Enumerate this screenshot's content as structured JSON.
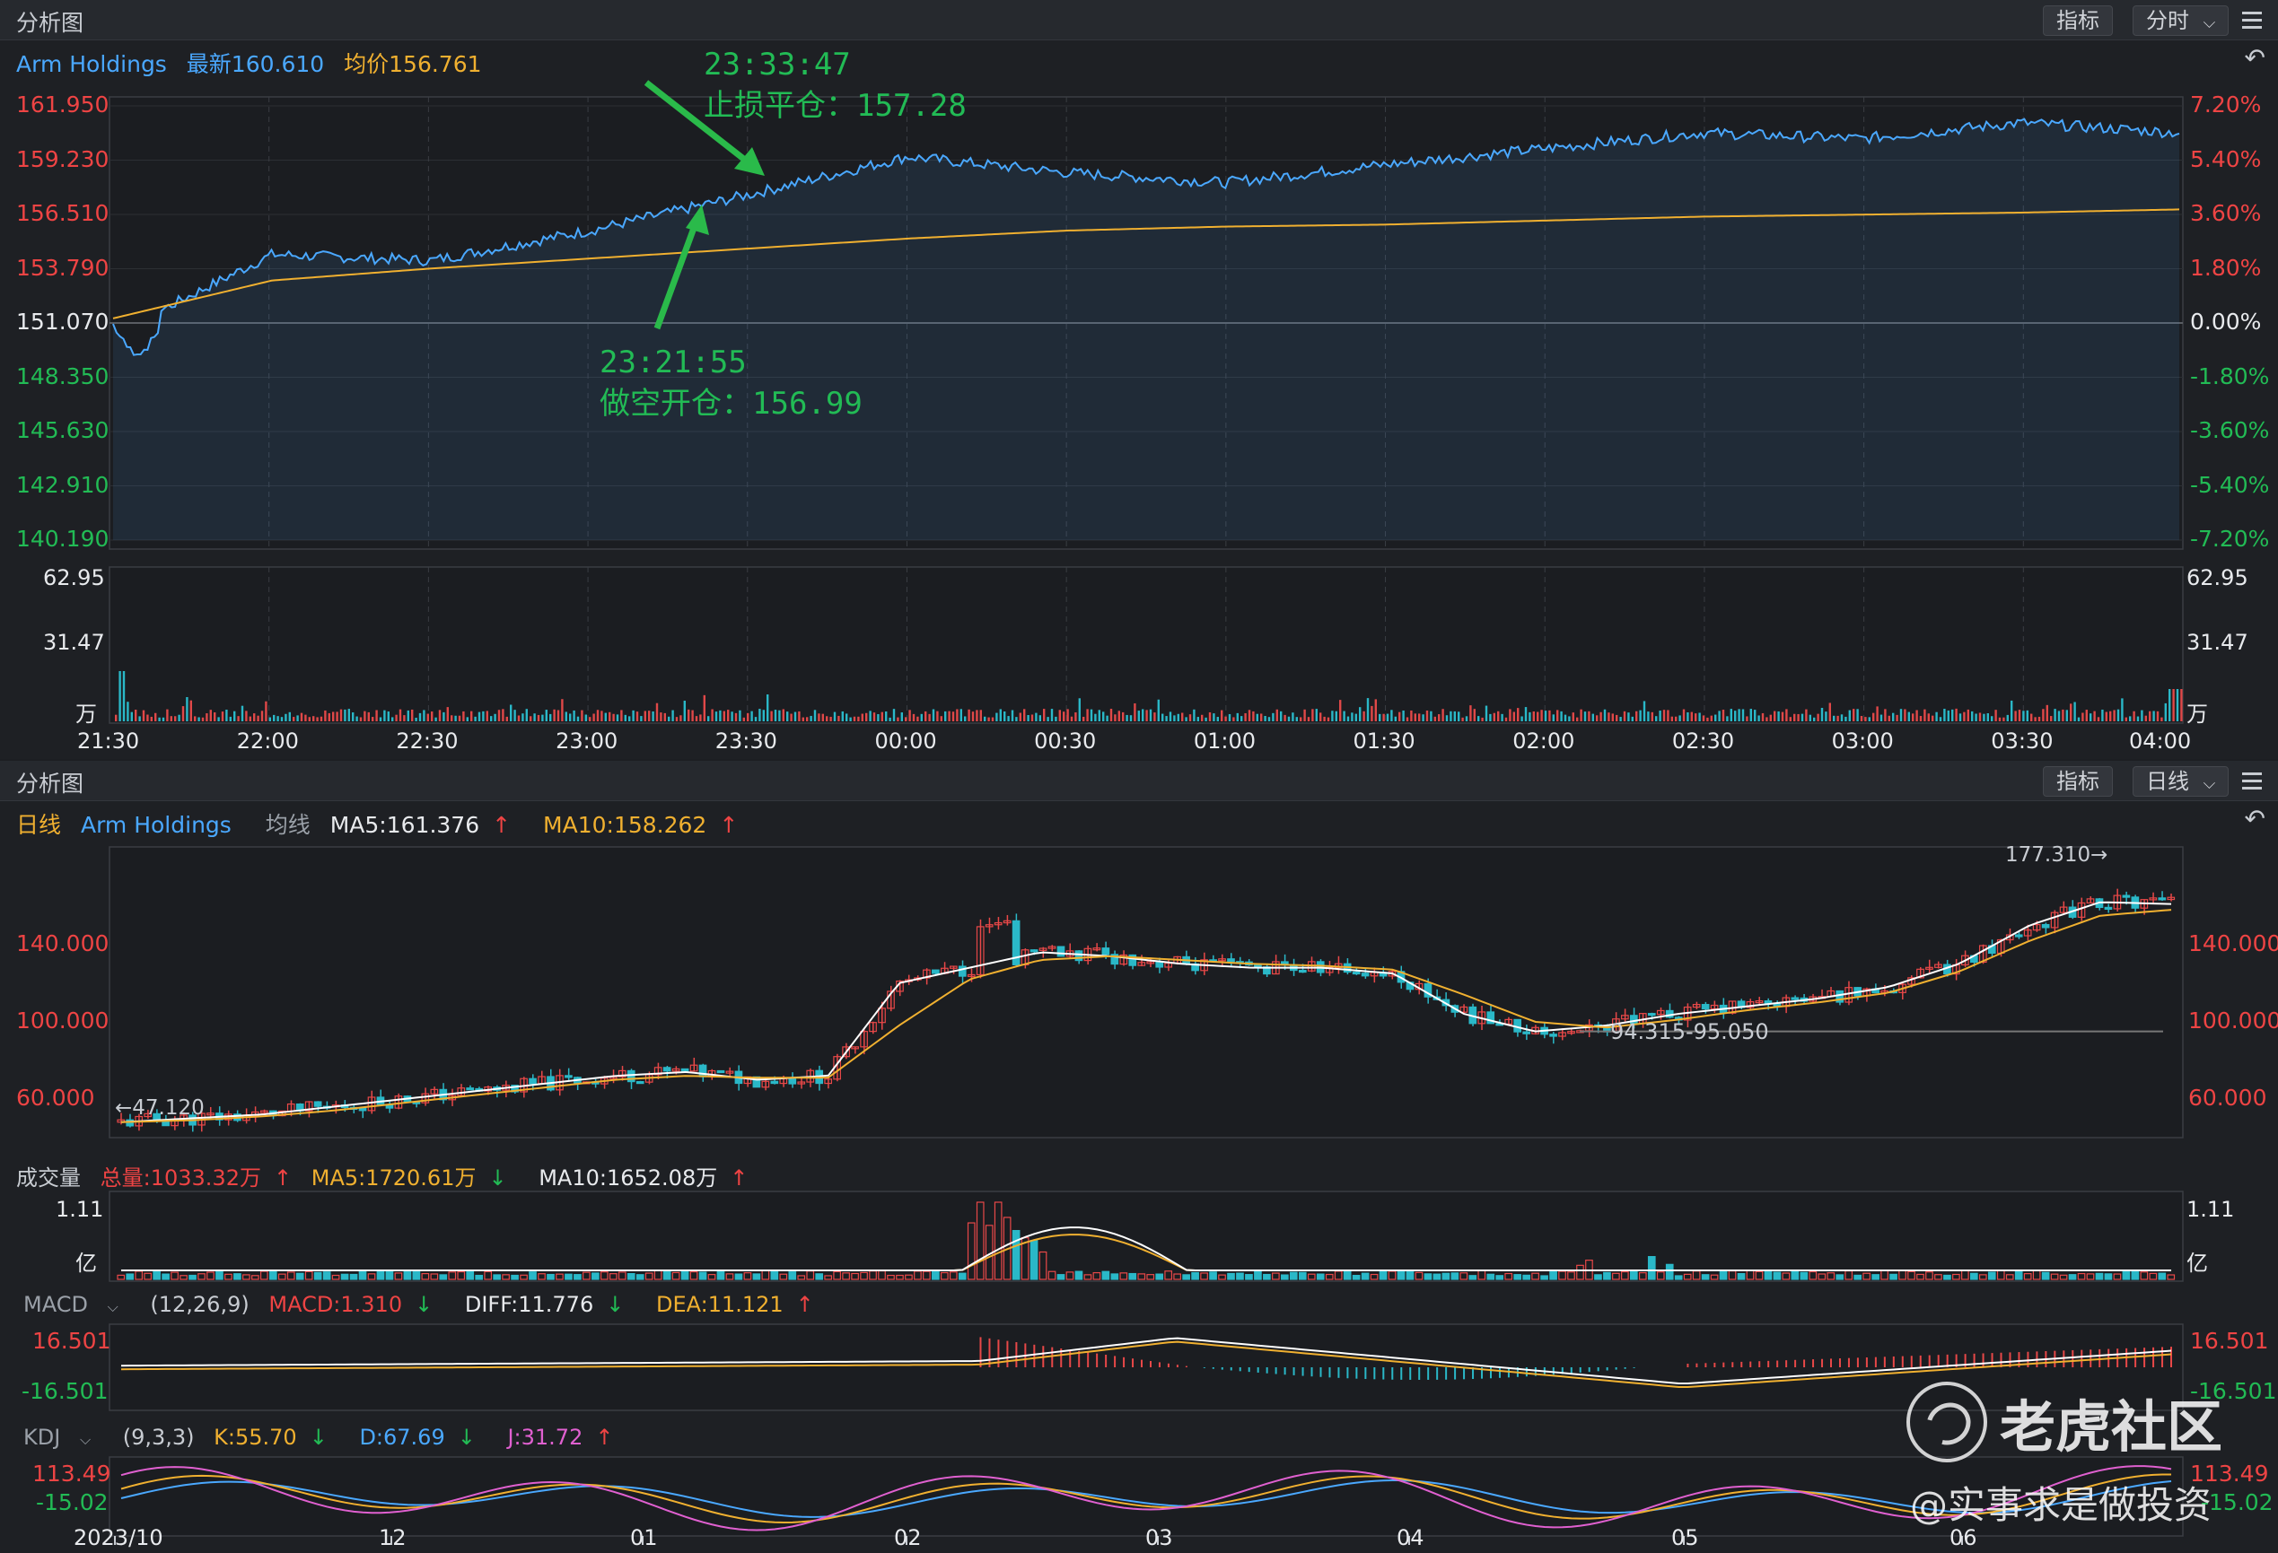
{
  "top": {
    "title": "分析图",
    "indicator_btn": "指标",
    "period_btn": "分时",
    "symbol": "Arm Holdings",
    "latest_label": "最新160.610",
    "avg_label": "均价156.761",
    "price_ticks": [
      "161.950",
      "159.230",
      "156.510",
      "153.790",
      "151.070",
      "148.350",
      "145.630",
      "142.910",
      "140.190"
    ],
    "pct_ticks": [
      "7.20%",
      "5.40%",
      "3.60%",
      "1.80%",
      "0.00%",
      "-1.80%",
      "-3.60%",
      "-5.40%",
      "-7.20%"
    ],
    "vol_ticks": [
      "62.95",
      "31.47",
      "万"
    ],
    "time_ticks": [
      "21:30",
      "22:00",
      "22:30",
      "23:00",
      "23:30",
      "00:00",
      "00:30",
      "01:00",
      "01:30",
      "02:00",
      "02:30",
      "03:00",
      "03:30",
      "04:00"
    ],
    "annotation_close_time": "23:33:47",
    "annotation_close_text": "止损平仓：157.28",
    "annotation_open_time": "23:21:55",
    "annotation_open_text": "做空开仓：156.99"
  },
  "bottom": {
    "title": "分析图",
    "indicator_btn": "指标",
    "period_btn": "日线",
    "period_label": "日线",
    "symbol": "Arm Holdings",
    "ma_label": "均线",
    "ma5": "MA5:161.376",
    "ma10": "MA10:158.262",
    "price_ticks": [
      "140.000",
      "100.000",
      "60.000"
    ],
    "high_marker": "177.310→",
    "low_marker": "←47.120",
    "range_marker": "94.315-95.050",
    "volume": {
      "label": "成交量",
      "total": "总量:1033.32万",
      "ma5": "MA5:1720.61万",
      "ma10": "MA10:1652.08万",
      "ticks": [
        "1.11",
        "亿"
      ]
    },
    "macd": {
      "name": "MACD",
      "params": "(12,26,9)",
      "macd": "MACD:1.310",
      "diff": "DIFF:11.776",
      "dea": "DEA:11.121",
      "ticks": [
        "16.501",
        "-16.501"
      ]
    },
    "kdj": {
      "name": "KDJ",
      "params": "(9,3,3)",
      "k": "K:55.70",
      "d": "D:67.69",
      "j": "J:31.72",
      "ticks": [
        "113.49",
        "-15.02"
      ]
    },
    "date_ticks": [
      "2023/10",
      "12",
      "01",
      "02",
      "03",
      "04",
      "05",
      "06"
    ]
  },
  "watermark": {
    "brand": "老虎社区",
    "author": "@实事求是做投资"
  },
  "chart_data": [
    {
      "type": "line",
      "title": "",
      "series": [
        {
          "name": "最新",
          "x": [
            "21:30",
            "22:00",
            "22:30",
            "23:00",
            "23:30",
            "00:00",
            "00:30",
            "01:00",
            "01:30",
            "02:00",
            "02:30",
            "03:00",
            "03:30",
            "04:00"
          ],
          "values": [
            150.5,
            154.5,
            154.2,
            155.7,
            157.5,
            159.4,
            158.6,
            158.1,
            159.0,
            159.8,
            160.6,
            160.3,
            161.1,
            160.6
          ]
        },
        {
          "name": "均价",
          "x": [
            "21:30",
            "22:00",
            "22:30",
            "23:00",
            "23:30",
            "00:00",
            "00:30",
            "01:00",
            "01:30",
            "02:00",
            "02:30",
            "03:00",
            "03:30",
            "04:00"
          ],
          "values": [
            151.3,
            153.2,
            153.8,
            154.3,
            154.8,
            155.3,
            155.7,
            155.9,
            156.0,
            156.2,
            156.4,
            156.5,
            156.6,
            156.761
          ]
        }
      ],
      "ylim": [
        140.19,
        161.95
      ],
      "annotations": [
        {
          "time": "23:21:55",
          "text": "做空开仓：156.99"
        },
        {
          "time": "23:33:47",
          "text": "止损平仓：157.28"
        }
      ]
    },
    {
      "type": "candlestick",
      "title": "",
      "series": [
        {
          "name": "MA5",
          "values": [
            48,
            50,
            52,
            56,
            60,
            64,
            68,
            72,
            74,
            70,
            72,
            120,
            128,
            136,
            134,
            130,
            128,
            128,
            125,
            104,
            95,
            98,
            104,
            108,
            112,
            118,
            130,
            150,
            162,
            161
          ]
        },
        {
          "name": "MA10",
          "values": [
            48,
            49,
            51,
            54,
            58,
            62,
            66,
            70,
            72,
            71,
            71,
            98,
            122,
            132,
            134,
            132,
            130,
            129,
            127,
            114,
            100,
            97,
            101,
            106,
            110,
            115,
            126,
            142,
            155,
            158
          ]
        }
      ],
      "ylim": [
        40,
        185
      ],
      "high": 177.31,
      "low": 47.12
    }
  ]
}
